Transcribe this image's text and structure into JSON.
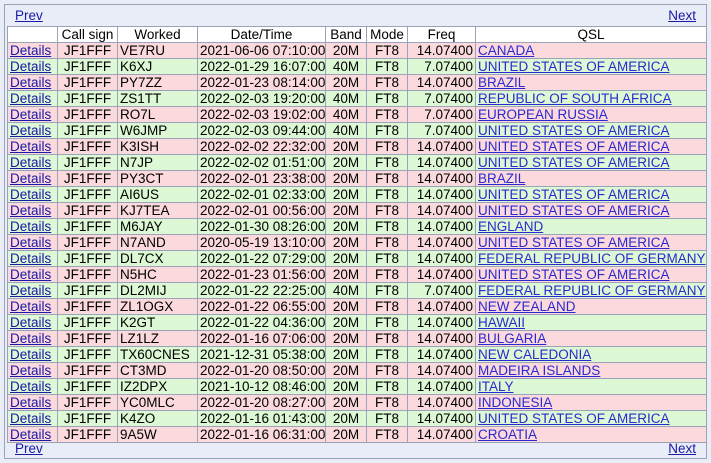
{
  "pager": {
    "prev_label": "Prev",
    "next_label": "Next"
  },
  "columns": [
    "",
    "Call sign",
    "Worked",
    "Date/Time",
    "Band",
    "Mode",
    "Freq",
    "QSL"
  ],
  "details_label": "Details",
  "rows": [
    {
      "call": "JF1FFF",
      "worked": "VE7RU",
      "datetime": "2021-06-06 07:10:00",
      "band": "20M",
      "mode": "FT8",
      "freq": "14.07400",
      "qsl": "CANADA"
    },
    {
      "call": "JF1FFF",
      "worked": "K6XJ",
      "datetime": "2022-01-29 16:07:00",
      "band": "40M",
      "mode": "FT8",
      "freq": "7.07400",
      "qsl": "UNITED STATES OF AMERICA"
    },
    {
      "call": "JF1FFF",
      "worked": "PY7ZZ",
      "datetime": "2022-01-23 08:14:00",
      "band": "20M",
      "mode": "FT8",
      "freq": "14.07400",
      "qsl": "BRAZIL"
    },
    {
      "call": "JF1FFF",
      "worked": "ZS1TT",
      "datetime": "2022-02-03 19:20:00",
      "band": "40M",
      "mode": "FT8",
      "freq": "7.07400",
      "qsl": "REPUBLIC OF SOUTH AFRICA"
    },
    {
      "call": "JF1FFF",
      "worked": "RO7L",
      "datetime": "2022-02-03 19:02:00",
      "band": "40M",
      "mode": "FT8",
      "freq": "7.07400",
      "qsl": "EUROPEAN RUSSIA"
    },
    {
      "call": "JF1FFF",
      "worked": "W6JMP",
      "datetime": "2022-02-03 09:44:00",
      "band": "40M",
      "mode": "FT8",
      "freq": "7.07400",
      "qsl": "UNITED STATES OF AMERICA"
    },
    {
      "call": "JF1FFF",
      "worked": "K3ISH",
      "datetime": "2022-02-02 22:32:00",
      "band": "20M",
      "mode": "FT8",
      "freq": "14.07400",
      "qsl": "UNITED STATES OF AMERICA"
    },
    {
      "call": "JF1FFF",
      "worked": "N7JP",
      "datetime": "2022-02-02 01:51:00",
      "band": "20M",
      "mode": "FT8",
      "freq": "14.07400",
      "qsl": "UNITED STATES OF AMERICA"
    },
    {
      "call": "JF1FFF",
      "worked": "PY3CT",
      "datetime": "2022-02-01 23:38:00",
      "band": "20M",
      "mode": "FT8",
      "freq": "14.07400",
      "qsl": "BRAZIL"
    },
    {
      "call": "JF1FFF",
      "worked": "AI6US",
      "datetime": "2022-02-01 02:33:00",
      "band": "20M",
      "mode": "FT8",
      "freq": "14.07400",
      "qsl": "UNITED STATES OF AMERICA"
    },
    {
      "call": "JF1FFF",
      "worked": "KJ7TEA",
      "datetime": "2022-02-01 00:56:00",
      "band": "20M",
      "mode": "FT8",
      "freq": "14.07400",
      "qsl": "UNITED STATES OF AMERICA"
    },
    {
      "call": "JF1FFF",
      "worked": "M6JAY",
      "datetime": "2022-01-30 08:26:00",
      "band": "20M",
      "mode": "FT8",
      "freq": "14.07400",
      "qsl": "ENGLAND"
    },
    {
      "call": "JF1FFF",
      "worked": "N7AND",
      "datetime": "2020-05-19 13:10:00",
      "band": "20M",
      "mode": "FT8",
      "freq": "14.07400",
      "qsl": "UNITED STATES OF AMERICA"
    },
    {
      "call": "JF1FFF",
      "worked": "DL7CX",
      "datetime": "2022-01-22 07:29:00",
      "band": "20M",
      "mode": "FT8",
      "freq": "14.07400",
      "qsl": "FEDERAL REPUBLIC OF GERMANY"
    },
    {
      "call": "JF1FFF",
      "worked": "N5HC",
      "datetime": "2022-01-23 01:56:00",
      "band": "20M",
      "mode": "FT8",
      "freq": "14.07400",
      "qsl": "UNITED STATES OF AMERICA"
    },
    {
      "call": "JF1FFF",
      "worked": "DL2MIJ",
      "datetime": "2022-01-22 22:25:00",
      "band": "40M",
      "mode": "FT8",
      "freq": "7.07400",
      "qsl": "FEDERAL REPUBLIC OF GERMANY"
    },
    {
      "call": "JF1FFF",
      "worked": "ZL1OGX",
      "datetime": "2022-01-22 06:55:00",
      "band": "20M",
      "mode": "FT8",
      "freq": "14.07400",
      "qsl": "NEW ZEALAND"
    },
    {
      "call": "JF1FFF",
      "worked": "K2GT",
      "datetime": "2022-01-22 04:36:00",
      "band": "20M",
      "mode": "FT8",
      "freq": "14.07400",
      "qsl": "HAWAII"
    },
    {
      "call": "JF1FFF",
      "worked": "LZ1LZ",
      "datetime": "2022-01-16 07:06:00",
      "band": "20M",
      "mode": "FT8",
      "freq": "14.07400",
      "qsl": "BULGARIA"
    },
    {
      "call": "JF1FFF",
      "worked": "TX60CNES",
      "datetime": "2021-12-31 05:38:00",
      "band": "20M",
      "mode": "FT8",
      "freq": "14.07400",
      "qsl": "NEW CALEDONIA"
    },
    {
      "call": "JF1FFF",
      "worked": "CT3MD",
      "datetime": "2022-01-20 08:50:00",
      "band": "20M",
      "mode": "FT8",
      "freq": "14.07400",
      "qsl": "MADEIRA ISLANDS"
    },
    {
      "call": "JF1FFF",
      "worked": "IZ2DPX",
      "datetime": "2021-10-12 08:46:00",
      "band": "20M",
      "mode": "FT8",
      "freq": "14.07400",
      "qsl": "ITALY"
    },
    {
      "call": "JF1FFF",
      "worked": "YC0MLC",
      "datetime": "2022-01-20 08:27:00",
      "band": "20M",
      "mode": "FT8",
      "freq": "14.07400",
      "qsl": "INDONESIA"
    },
    {
      "call": "JF1FFF",
      "worked": "K4ZO",
      "datetime": "2022-01-16 01:43:00",
      "band": "20M",
      "mode": "FT8",
      "freq": "14.07400",
      "qsl": "UNITED STATES OF AMERICA"
    },
    {
      "call": "JF1FFF",
      "worked": "9A5W",
      "datetime": "2022-01-16 06:31:00",
      "band": "20M",
      "mode": "FT8",
      "freq": "14.07400",
      "qsl": "CROATIA"
    }
  ]
}
